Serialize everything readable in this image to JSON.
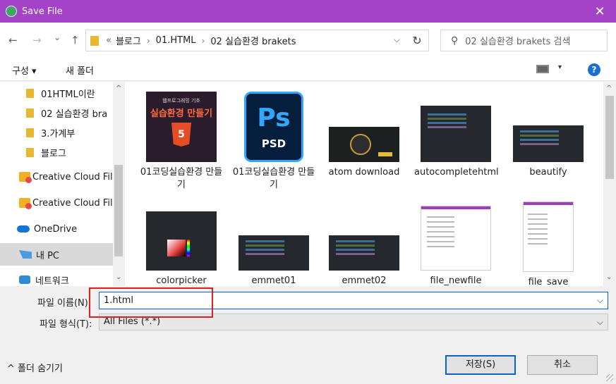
{
  "window": {
    "title": "Save File",
    "close_label": "✕"
  },
  "nav": {
    "back": "←",
    "forward": "→",
    "recent": "⌄",
    "up": "↑"
  },
  "address": {
    "overflow": "«",
    "crumbs": [
      "블로그",
      "01.HTML",
      "02 실습환경 brakets"
    ],
    "sep": "›",
    "dropdown": "⌵",
    "refresh": "↻"
  },
  "search": {
    "icon": "⚲",
    "placeholder": "02 실습환경 brakets 검색"
  },
  "toolbar": {
    "organize": "구성 ▾",
    "new_folder": "새 폴더",
    "view_drop": "▾",
    "help": "?"
  },
  "sidebar": {
    "items": [
      {
        "label": "01HTML이란",
        "icon": "folder-icon"
      },
      {
        "label": "02 실습환경 bra",
        "icon": "folder-icon"
      },
      {
        "label": "3.가계부",
        "icon": "folder-icon"
      },
      {
        "label": "블로그",
        "icon": "folder-icon"
      },
      {
        "label": "Creative Cloud Fil",
        "icon": "creative-cloud-icon"
      },
      {
        "label": "Creative Cloud Fil",
        "icon": "creative-cloud-icon"
      },
      {
        "label": "OneDrive",
        "icon": "onedrive-icon"
      },
      {
        "label": "내 PC",
        "icon": "pc-icon"
      },
      {
        "label": "네트워크",
        "icon": "network-icon"
      }
    ],
    "scroll_up": "^",
    "scroll_down": "⌄"
  },
  "files": {
    "items": [
      {
        "name": "01코딩실습환경 만들기",
        "thumb": "html-thumb",
        "thumb_text_1": "웹프로그래밍 기초",
        "thumb_text_2": "실습환경 만들기",
        "thumb_badge": "5"
      },
      {
        "name": "01코딩실습환경 만들기",
        "thumb": "photoshop-thumb",
        "thumb_text_1": "Ps",
        "thumb_text_2": "PSD"
      },
      {
        "name": "atom download",
        "thumb": "atom-thumb"
      },
      {
        "name": "autocompletehtml",
        "thumb": "code-thumb"
      },
      {
        "name": "beautify",
        "thumb": "code-thumb"
      },
      {
        "name": "colorpicker",
        "thumb": "colorpicker-thumb"
      },
      {
        "name": "emmet01",
        "thumb": "code-thumb"
      },
      {
        "name": "emmet02",
        "thumb": "code-thumb"
      },
      {
        "name": "file_newfile",
        "thumb": "light-thumb"
      },
      {
        "name": "file_save",
        "thumb": "light-thumb"
      }
    ],
    "scroll_up": "^",
    "scroll_down": "⌄"
  },
  "bottom": {
    "filename_label": "파일 이름(N):",
    "filename_value": "1.html",
    "filetype_label": "파일 형식(T):",
    "filetype_value": "All Files (*.*)",
    "dropdown": "⌵",
    "hide_folders": "^ 폴더 숨기기",
    "save": "저장(S)",
    "cancel": "취소"
  },
  "colors": {
    "titlebar": "#a443c8",
    "accent": "#0a64c7",
    "highlight": "#e02020"
  }
}
